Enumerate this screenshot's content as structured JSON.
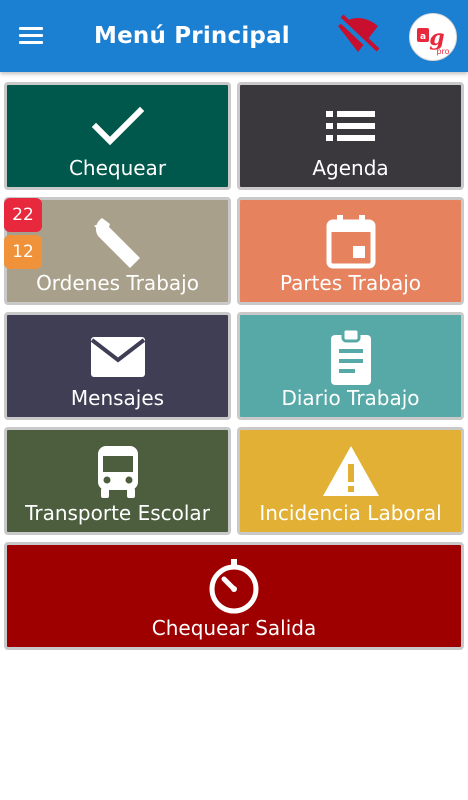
{
  "header": {
    "title": "Menú Principal",
    "menu_icon": "hamburger-menu-icon",
    "status_icon": "wifi-off-icon",
    "status_color": "#c8102e",
    "logo_text": "g",
    "logo_sub": "pro"
  },
  "colors": {
    "appbar": "#1b7fd2",
    "chequear": "#00574b",
    "agenda": "#3a373d",
    "ordenes": "#a8a08a",
    "partes": "#e7825f",
    "mensajes": "#3f3e54",
    "diario": "#57a9a7",
    "transporte": "#4c5e3e",
    "incidencia": "#e2b034",
    "salida": "#9e0000",
    "badge_red": "#e8283c",
    "badge_orange": "#f0923a"
  },
  "tiles": {
    "chequear": {
      "label": "Chequear",
      "icon": "checkmark-icon"
    },
    "agenda": {
      "label": "Agenda",
      "icon": "list-icon"
    },
    "ordenes": {
      "label": "Ordenes Trabajo",
      "icon": "wrench-icon",
      "badges": [
        "22",
        "12"
      ]
    },
    "partes": {
      "label": "Partes Trabajo",
      "icon": "calendar-icon"
    },
    "mensajes": {
      "label": "Mensajes",
      "icon": "envelope-icon"
    },
    "diario": {
      "label": "Diario Trabajo",
      "icon": "clipboard-icon"
    },
    "transporte": {
      "label": "Transporte Escolar",
      "icon": "bus-icon"
    },
    "incidencia": {
      "label": "Incidencia Laboral",
      "icon": "warning-icon"
    },
    "salida": {
      "label": "Chequear Salida",
      "icon": "timer-icon"
    }
  }
}
